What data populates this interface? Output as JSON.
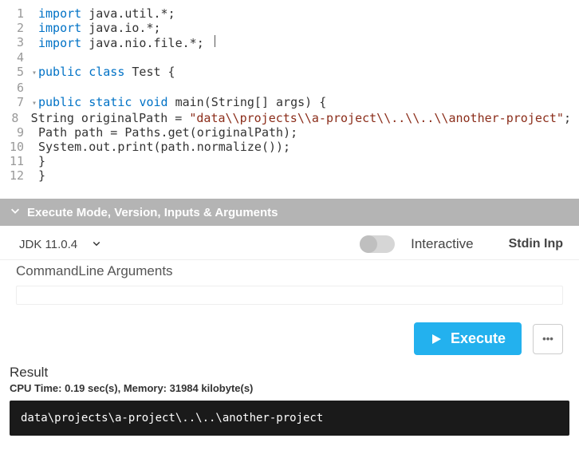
{
  "editor": {
    "lines": [
      {
        "n": "1",
        "fold": "",
        "tokens": [
          [
            "kw",
            "import"
          ],
          [
            "p",
            " "
          ],
          [
            "id",
            "java.util.*"
          ],
          [
            "p",
            ";"
          ]
        ]
      },
      {
        "n": "2",
        "fold": "",
        "tokens": [
          [
            "kw",
            "import"
          ],
          [
            "p",
            " "
          ],
          [
            "id",
            "java.io.*"
          ],
          [
            "p",
            ";"
          ]
        ]
      },
      {
        "n": "3",
        "fold": "",
        "tokens": [
          [
            "kw",
            "import"
          ],
          [
            "p",
            " "
          ],
          [
            "id",
            "java.nio.file.*"
          ],
          [
            "p",
            "; "
          ],
          [
            "cursor",
            ""
          ]
        ]
      },
      {
        "n": "4",
        "fold": "",
        "tokens": []
      },
      {
        "n": "5",
        "fold": "▾",
        "tokens": [
          [
            "kw",
            "public"
          ],
          [
            "p",
            " "
          ],
          [
            "kw",
            "class"
          ],
          [
            "p",
            " "
          ],
          [
            "cls",
            "Test"
          ],
          [
            "p",
            " {"
          ]
        ]
      },
      {
        "n": "6",
        "fold": "",
        "tokens": []
      },
      {
        "n": "7",
        "fold": "▾",
        "indent": 2,
        "tokens": [
          [
            "kw",
            "public"
          ],
          [
            "p",
            " "
          ],
          [
            "kw",
            "static"
          ],
          [
            "p",
            " "
          ],
          [
            "kw",
            "void"
          ],
          [
            "p",
            " "
          ],
          [
            "id",
            "main"
          ],
          [
            "p",
            "("
          ],
          [
            "tp",
            "String[]"
          ],
          [
            "p",
            " "
          ],
          [
            "id",
            "args"
          ],
          [
            "p",
            ") {"
          ]
        ]
      },
      {
        "n": "8",
        "fold": "",
        "indent": 3,
        "tokens": [
          [
            "tp",
            "String"
          ],
          [
            "p",
            " "
          ],
          [
            "id",
            "originalPath"
          ],
          [
            "p",
            " = "
          ],
          [
            "str",
            "\"data\\\\projects\\\\a-project\\\\..\\\\..\\\\another-project\""
          ],
          [
            "p",
            ";"
          ]
        ]
      },
      {
        "n": "9",
        "fold": "",
        "tokens": [
          [
            "tp",
            "Path"
          ],
          [
            "p",
            " "
          ],
          [
            "id",
            "path"
          ],
          [
            "p",
            " = "
          ],
          [
            "id",
            "Paths"
          ],
          [
            "p",
            "."
          ],
          [
            "id",
            "get"
          ],
          [
            "p",
            "("
          ],
          [
            "id",
            "originalPath"
          ],
          [
            "p",
            ");"
          ]
        ]
      },
      {
        "n": "10",
        "fold": "",
        "tokens": [
          [
            "id",
            "System"
          ],
          [
            "p",
            "."
          ],
          [
            "id",
            "out"
          ],
          [
            "p",
            "."
          ],
          [
            "id",
            "print"
          ],
          [
            "p",
            "("
          ],
          [
            "id",
            "path"
          ],
          [
            "p",
            "."
          ],
          [
            "id",
            "normalize"
          ],
          [
            "p",
            "());"
          ]
        ]
      },
      {
        "n": "11",
        "fold": "",
        "indent": 2,
        "tokens": [
          [
            "p",
            "}"
          ]
        ]
      },
      {
        "n": "12",
        "fold": "",
        "tokens": [
          [
            "p",
            "}"
          ]
        ]
      }
    ]
  },
  "accordion": {
    "title": "Execute Mode, Version, Inputs & Arguments"
  },
  "settings": {
    "jdk_label": "JDK 11.0.4",
    "interactive_label": "Interactive",
    "stdin_label": "Stdin Inp",
    "args_label": "CommandLine Arguments"
  },
  "execute": {
    "button_label": "Execute",
    "more_label": "•••"
  },
  "result": {
    "label": "Result",
    "stats": "CPU Time: 0.19 sec(s), Memory: 31984 kilobyte(s)",
    "output": "data\\projects\\a-project\\..\\..\\another-project"
  }
}
